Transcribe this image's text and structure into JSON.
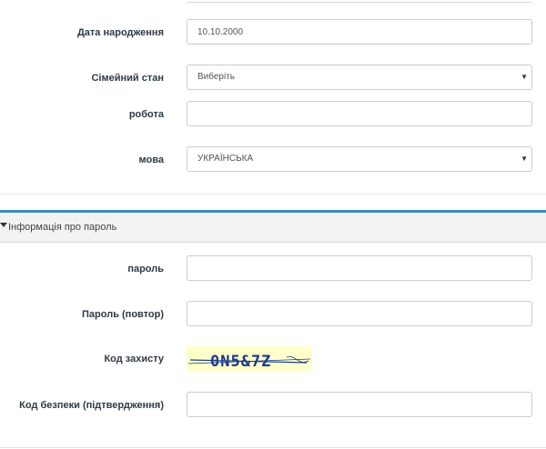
{
  "personal": {
    "birth_date": {
      "label": "Дата народження",
      "value": "10.10.2000"
    },
    "marital_status": {
      "label": "Сімейний стан",
      "value": "Виберіть"
    },
    "work": {
      "label": "робота",
      "value": ""
    },
    "language": {
      "label": "мова",
      "value": "УКРАЇНСЬКА"
    }
  },
  "password_section": {
    "title": "Інформація про пароль",
    "password": {
      "label": "пароль",
      "value": ""
    },
    "password_repeat": {
      "label": "Пароль (повтор)",
      "value": ""
    },
    "captcha": {
      "label": "Код захисту",
      "text": "0N5&7Z"
    },
    "captcha_confirm": {
      "label": "Код безпеки (підтвердження)",
      "value": ""
    }
  },
  "colors": {
    "accent": "#3c8dbc",
    "captcha_bg": "#ffffcc",
    "captcha_text": "#1f3a8a"
  },
  "icons": {
    "section_toggle": "caret-down-icon",
    "select_arrow": "triangle-down-icon"
  }
}
